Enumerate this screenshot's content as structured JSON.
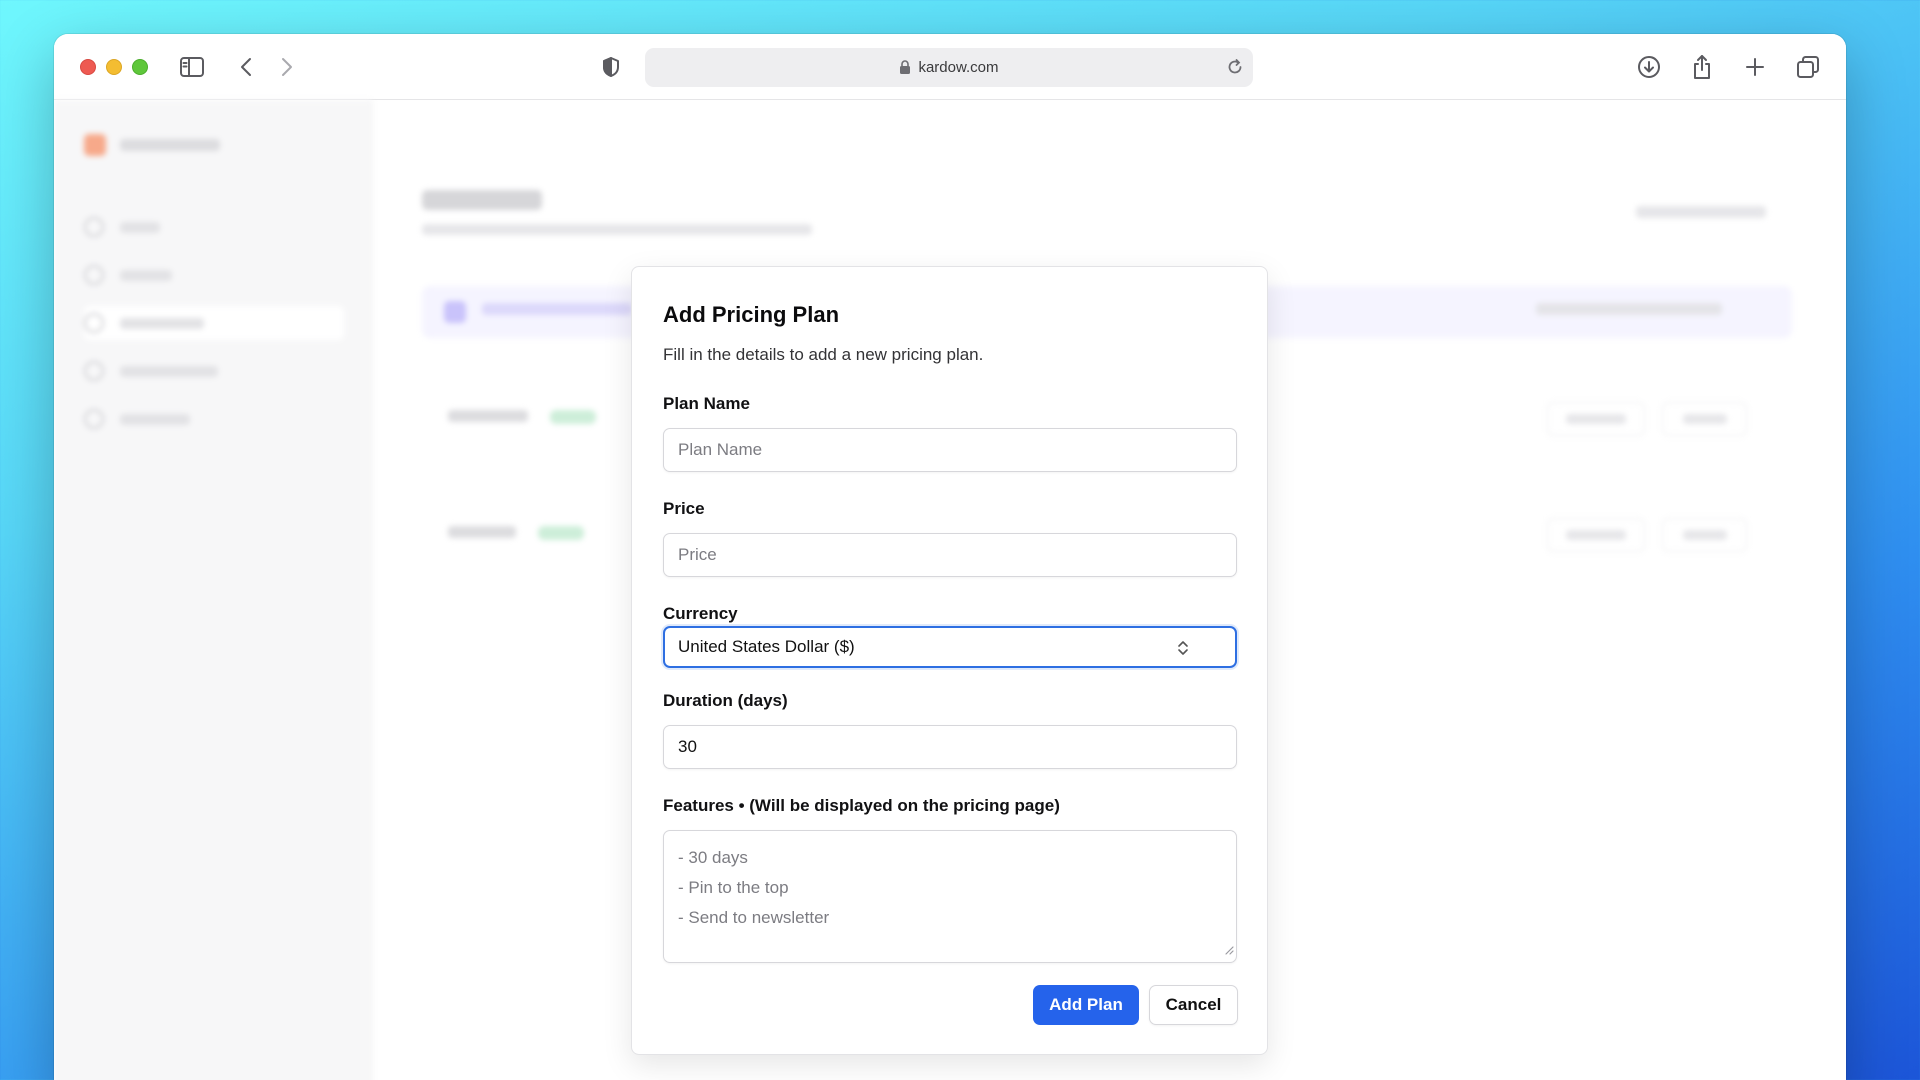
{
  "browser": {
    "url": "kardow.com",
    "icons": [
      "sidebar-toggle-icon",
      "back-icon",
      "forward-icon",
      "privacy-shield-icon",
      "lock-icon",
      "reload-icon",
      "download-icon",
      "share-icon",
      "new-tab-icon",
      "tab-overview-icon"
    ]
  },
  "modal": {
    "title": "Add Pricing Plan",
    "description": "Fill in the details to add a new pricing plan.",
    "plan_name": {
      "label": "Plan Name",
      "placeholder": "Plan Name",
      "value": ""
    },
    "price": {
      "label": "Price",
      "placeholder": "Price",
      "value": ""
    },
    "currency": {
      "label": "Currency",
      "value": "United States Dollar ($)"
    },
    "duration": {
      "label": "Duration (days)",
      "value": "30"
    },
    "features": {
      "label": "Features • (Will be displayed on the pricing page)",
      "placeholder_lines": [
        "- 30 days",
        "- Pin to the top",
        "- Send to newsletter"
      ]
    },
    "add_button": "Add Plan",
    "cancel_button": "Cancel"
  },
  "colors": {
    "primary": "#2563eb",
    "focus_ring": "#2e6fe2",
    "background_gradient_top": "#6ff7fd",
    "background_gradient_bottom": "#1c55d8"
  }
}
